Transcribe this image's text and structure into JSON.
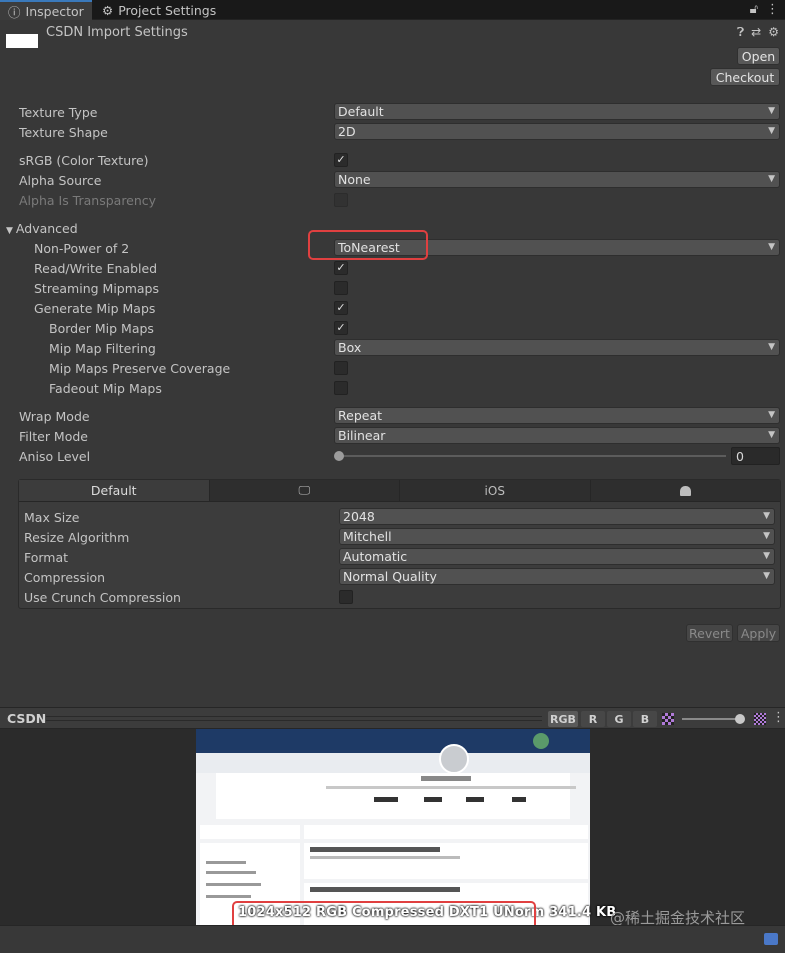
{
  "tabs": [
    {
      "label": "Inspector"
    },
    {
      "label": "Project Settings"
    }
  ],
  "header": {
    "title": "CSDN Import Settings",
    "open_label": "Open",
    "checkout_label": "Checkout"
  },
  "fields": {
    "texture_type": {
      "label": "Texture Type",
      "value": "Default"
    },
    "texture_shape": {
      "label": "Texture Shape",
      "value": "2D"
    },
    "srgb": {
      "label": "sRGB (Color Texture)",
      "checked": true
    },
    "alpha_source": {
      "label": "Alpha Source",
      "value": "None"
    },
    "alpha_transparency": {
      "label": "Alpha Is Transparency",
      "checked": false
    },
    "advanced": {
      "label": "Advanced"
    },
    "npot": {
      "label": "Non-Power of 2",
      "value": "ToNearest"
    },
    "read_write": {
      "label": "Read/Write Enabled",
      "checked": true
    },
    "streaming": {
      "label": "Streaming Mipmaps",
      "checked": false
    },
    "gen_mip": {
      "label": "Generate Mip Maps",
      "checked": true
    },
    "border_mip": {
      "label": "Border Mip Maps",
      "checked": true
    },
    "mip_filter": {
      "label": "Mip Map Filtering",
      "value": "Box"
    },
    "mip_coverage": {
      "label": "Mip Maps Preserve Coverage",
      "checked": false
    },
    "fadeout": {
      "label": "Fadeout Mip Maps",
      "checked": false
    },
    "wrap_mode": {
      "label": "Wrap Mode",
      "value": "Repeat"
    },
    "filter_mode": {
      "label": "Filter Mode",
      "value": "Bilinear"
    },
    "aniso": {
      "label": "Aniso Level",
      "value": "0"
    }
  },
  "platform": {
    "tabs": [
      {
        "label": "Default"
      },
      {
        "label": ""
      },
      {
        "label": "iOS"
      },
      {
        "label": ""
      }
    ],
    "max_size": {
      "label": "Max Size",
      "value": "2048"
    },
    "resize": {
      "label": "Resize Algorithm",
      "value": "Mitchell"
    },
    "format": {
      "label": "Format",
      "value": "Automatic"
    },
    "compression": {
      "label": "Compression",
      "value": "Normal Quality"
    },
    "crunch": {
      "label": "Use Crunch Compression",
      "checked": false
    }
  },
  "actions": {
    "revert_label": "Revert",
    "apply_label": "Apply"
  },
  "preview": {
    "title": "CSDN",
    "channels": [
      "RGB",
      "R",
      "G",
      "B"
    ],
    "info": "1024x512  RGB Compressed DXT1 UNorm   341.4 KB",
    "watermark": "@稀土掘金技术社区"
  },
  "colors": {
    "highlight": "#e04040",
    "accent": "#3a79bb"
  }
}
